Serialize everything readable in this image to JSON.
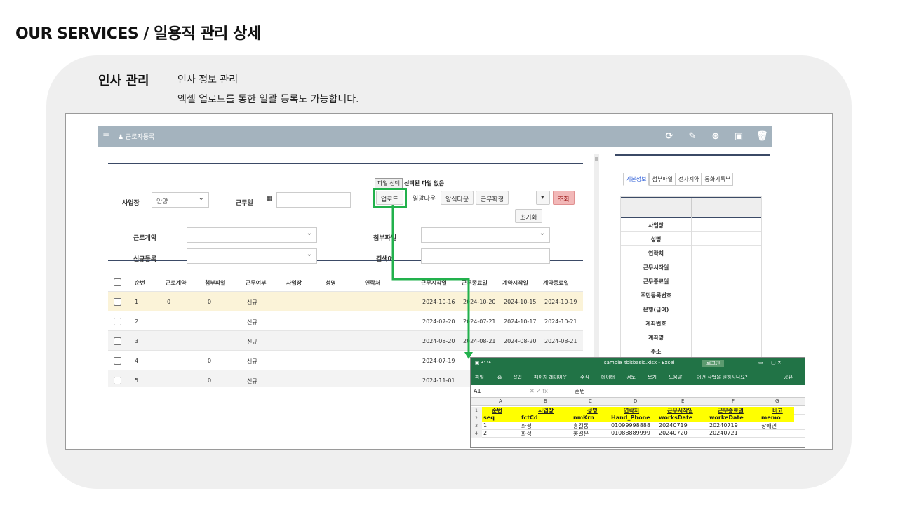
{
  "heading": "OUR SERVICES / 일용직 관리 상세",
  "intro": {
    "title": "인사 관리",
    "line1": "인사 정보 관리",
    "line2": "엑셀 업로드를 통한 일괄 등록도 가능합니다."
  },
  "appbar": {
    "menu_icon": "≡",
    "title": "♟ 근로자등록",
    "tools": [
      "⟳",
      "✎",
      "⊕",
      "▣",
      "🗑"
    ]
  },
  "form": {
    "site_label": "사업장",
    "site_value": "안양",
    "workday_label": "근무일",
    "calendar_icon": "▦",
    "file_button": "파일 선택",
    "file_status": "선택된 파일 없음",
    "buttons": [
      "업로드",
      "일괄다운",
      "양식다운",
      "근무확정"
    ],
    "dropdown": "▾",
    "search": "조회",
    "reset": "초기화",
    "contract_label": "근로계약",
    "attach_label": "첨부파일",
    "newreg_label": "신규등록",
    "searchword_label": "검색어"
  },
  "grid": {
    "headers": [
      "순번",
      "근로계약",
      "첨부파일",
      "근무여부",
      "사업장",
      "성명",
      "연락처",
      "근무시작일",
      "근무종료일",
      "계약시작일",
      "계약종료일"
    ],
    "rows": [
      [
        "1",
        "0",
        "0",
        "신규",
        "2024-10-16",
        "2024-10-20",
        "2024-10-15",
        "2024-10-19"
      ],
      [
        "2",
        "",
        "",
        "신규",
        "2024-07-20",
        "2024-07-21",
        "2024-10-17",
        "2024-10-21"
      ],
      [
        "3",
        "",
        "",
        "신규",
        "2024-08-20",
        "2024-08-21",
        "2024-08-20",
        "2024-08-21"
      ],
      [
        "4",
        "",
        "0",
        "신규",
        "2024-07-19",
        "",
        "",
        ""
      ],
      [
        "5",
        "",
        "0",
        "신규",
        "2024-11-01",
        "",
        "",
        ""
      ]
    ]
  },
  "right": {
    "tabs": [
      "기본정보",
      "첨부파일",
      "전자계약",
      "통화기록부"
    ],
    "fields": [
      "사업장",
      "성명",
      "연락처",
      "근무시작일",
      "근무종료일",
      "주민등록번호",
      "은행(급여)",
      "계좌번호",
      "계좌명",
      "주소"
    ]
  },
  "excel": {
    "filename": "sample_tbltbasic.xlsx - Excel",
    "login": "로그인",
    "ribbon": [
      "파일",
      "홈",
      "삽입",
      "페이지 레이아웃",
      "수식",
      "데이터",
      "검토",
      "보기",
      "도움말",
      "어떤 작업을 원하시나요?",
      "공유"
    ],
    "cell_ref": "A1",
    "formula_value": "순번",
    "columns": [
      "A",
      "B",
      "C",
      "D",
      "E",
      "F",
      "G"
    ],
    "row1": [
      "순번",
      "사업장",
      "성명",
      "연락처",
      "근무시작일",
      "근무종료일",
      "비고"
    ],
    "row2": [
      "seq",
      "fctCd",
      "nmKrn",
      "Hand_Phone",
      "worksDate",
      "workeDate",
      "memo"
    ],
    "row3": [
      "1",
      "화성",
      "홍길동",
      "01099998888",
      "20240719",
      "20240719",
      "장애인"
    ],
    "row4": [
      "2",
      "화성",
      "홍길은",
      "01088889999",
      "20240720",
      "20240721",
      ""
    ]
  }
}
